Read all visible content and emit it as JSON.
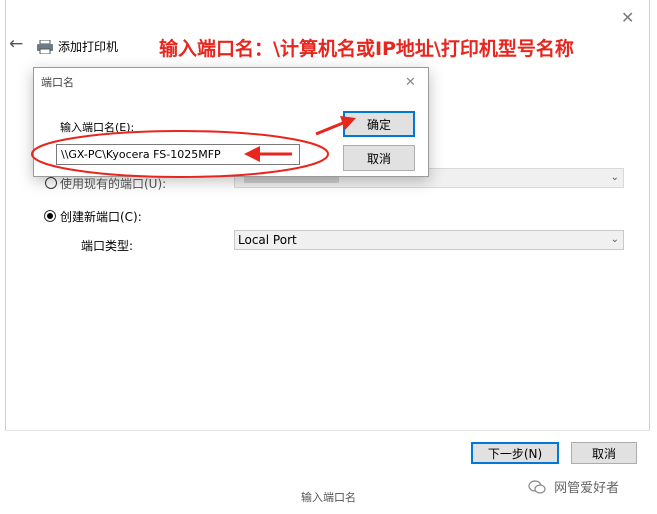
{
  "wizard": {
    "title": "添加打印机",
    "close_glyph": "✕",
    "back_glyph": "←",
    "annotation": "输入端口名：\\计算机名或IP地址\\打印机型号名称",
    "use_existing_label": "使用现有的端口(U):",
    "create_new_label": "创建新端口(C):",
    "port_type_label": "端口类型:",
    "port_type_value": "Local Port",
    "next_button": "下一步(N)",
    "cancel_button": "取消"
  },
  "dialog": {
    "title": "端口名",
    "close_glyph": "✕",
    "field_label": "输入端口名(E):",
    "field_value": "\\\\GX-PC\\Kyocera FS-1025MFP",
    "ok_button": "确定",
    "cancel_button": "取消"
  },
  "caption": "输入端口名",
  "watermark": "网管爱好者",
  "colors": {
    "annotation_red": "#e8261e",
    "focus_blue": "#0078d7"
  },
  "icons": [
    "printer-icon",
    "back-arrow-icon",
    "close-icon",
    "chevron-down-icon",
    "wechat-icon"
  ]
}
